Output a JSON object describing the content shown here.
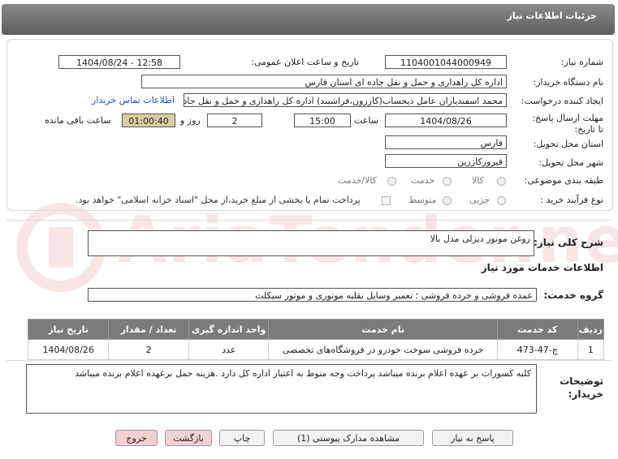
{
  "header": {
    "title": "جزئیات اطلاعات نیاز"
  },
  "form": {
    "need_number_label": "شماره نیاز:",
    "need_number": "1104001044000949",
    "announce_label": "تاریخ و ساعت اعلان عمومی:",
    "announce_value": "1404/08/24 - 12:58",
    "buyer_org_label": "نام دستگاه خریدار:",
    "buyer_org": "اداره کل راهداری و حمل و نقل جاده ای استان فارس",
    "requester_label": "ایجاد کننده درخواست:",
    "requester": "محمد اسفندیاران عامل ذیحساب(کازرون،فراشبند) اداره کل راهداری و حمل و نقل جاده ای استان فارس",
    "contact_link": "اطلاعات تماس خریدار",
    "deadline_label": "مهلت ارسال پاسخ: تا تاریخ:",
    "deadline_date": "1404/08/26",
    "time_label": "ساعت",
    "deadline_time": "15:00",
    "days_value": "2",
    "days_label": "روز و",
    "remaining_time": "01:00:40",
    "remaining_label": "ساعت باقی مانده",
    "province_label": "استان محل تحویل:",
    "province": "فارس",
    "city_label": "شهر محل تحویل:",
    "city": "فیروزکازرین",
    "category_label": "طبقه بندی موضوعی:",
    "category_options": [
      "کالا",
      "خدمت",
      "کالا/خدمت"
    ],
    "purchase_type_label": "نوع فرآیند خرید :",
    "purchase_type_options": [
      "جزیی",
      "متوسط"
    ],
    "payment_note": "پرداخت تمام یا بخشی از مبلغ خرید،از محل \"اسناد خزانه اسلامی\" خواهد بود."
  },
  "summary": {
    "label": "شرح کلی نیاز:",
    "value": "روغن موتور دیزلی مدل بالا"
  },
  "services": {
    "section_title": "اطلاعات خدمات مورد نیاز",
    "group_label": "گروه خدمت:",
    "group_value": "عمده فروشی و خرده فروشی ؛ تعمیر وسایل نقلیه موتوری و موتور سیکلت"
  },
  "table": {
    "headers": [
      "ردیف",
      "کد خدمت",
      "نام خدمت",
      "واحد اندازه گیری",
      "تعداد / مقدار",
      "تاریخ نیاز"
    ],
    "rows": [
      [
        "1",
        "چ-47-473",
        "خرده فروشی سوخت خودرو در فروشگاه‌های تخصصی",
        "عدد",
        "2",
        "1404/08/26"
      ]
    ]
  },
  "notes": {
    "label": "توضیحات خریدار:",
    "value": "کلیه کسورات بر عهده اعلام برنده میباشد پرداخت وجه منوط به اعتبار اداره کل دارد .هزینه حمل برعهده اعلام برنده میباشد"
  },
  "buttons": {
    "reply": "پاسخ به نیاز",
    "attachments": "مشاهده مدارک پیوستی (1)",
    "print": "چاپ",
    "back": "بازگشت",
    "exit": "خروج"
  },
  "watermark": {
    "text": "AriaTender.neT"
  },
  "colors": {
    "header_bg": "#6e6e6e",
    "timer_bg": "#d9cda3",
    "link": "#1a56c8",
    "table_head": "#7b7b7b",
    "exit_btn": "#f3cfcf"
  }
}
